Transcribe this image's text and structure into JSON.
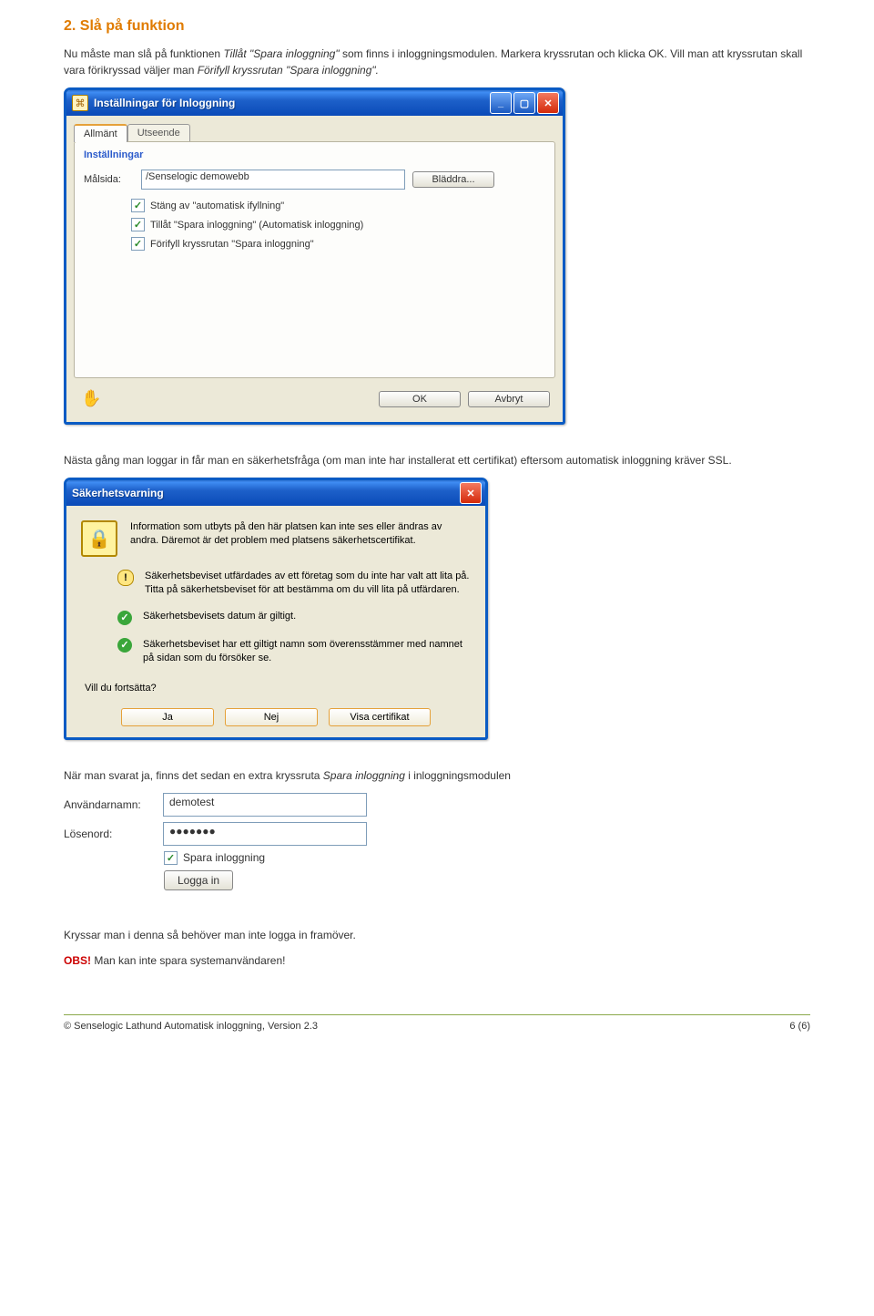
{
  "heading": "2. Slå på funktion",
  "intro1": "Nu måste man slå på funktionen ",
  "intro1_em": "Tillåt \"Spara inloggning\"",
  "intro1_cont": " som finns i inloggningsmodulen. Markera kryssrutan och klicka OK. Vill man att kryssrutan skall vara förikryssad väljer man ",
  "intro1_em2": "Förifyll kryssrutan \"Spara inloggning\".",
  "xpwin": {
    "title": "Inställningar för Inloggning",
    "tabs": [
      "Allmänt",
      "Utseende"
    ],
    "group_title": "Inställningar",
    "malsida_label": "Målsida:",
    "malsida_value": "/Senselogic demowebb",
    "browse": "Bläddra...",
    "checks": [
      "Stäng av \"automatisk ifyllning\"",
      "Tillåt \"Spara inloggning\" (Automatisk inloggning)",
      "Förifyll kryssrutan \"Spara inloggning\""
    ],
    "ok": "OK",
    "cancel": "Avbryt"
  },
  "para2": "Nästa gång man loggar in får man en säkerhetsfråga (om man inte har installerat ett certifikat) eftersom automatisk inloggning kräver SSL.",
  "sec": {
    "title": "Säkerhetsvarning",
    "msg1": "Information som utbyts på den här platsen kan inte ses eller ändras av andra. Däremot är det problem med platsens säkerhetscertifikat.",
    "item1": "Säkerhetsbeviset utfärdades av ett företag som du inte har valt att lita på. Titta på säkerhetsbeviset för att bestämma om du vill lita på utfärdaren.",
    "item2": "Säkerhetsbevisets datum är giltigt.",
    "item3": "Säkerhetsbeviset har ett giltigt namn som överensstämmer med namnet på sidan som du försöker se.",
    "question": "Vill du fortsätta?",
    "yes": "Ja",
    "no": "Nej",
    "show": "Visa certifikat"
  },
  "para3a": "När man svarat ja, finns det sedan en extra kryssruta ",
  "para3b": "Spara inloggning",
  "para3c": "  i inloggningsmodulen",
  "login": {
    "user_label": "Användarnamn:",
    "user_value": "demotest",
    "pass_label": "Lösenord:",
    "pass_value": "●●●●●●●",
    "remember": "Spara inloggning",
    "submit": "Logga in"
  },
  "para4": "Kryssar man i denna så behöver man inte logga in framöver.",
  "obs_label": "OBS!",
  "obs_text": " Man kan inte spara systemanvändaren!",
  "footer_left": "© Senselogic Lathund Automatisk inloggning, Version 2.3",
  "footer_right": "6 (6)"
}
